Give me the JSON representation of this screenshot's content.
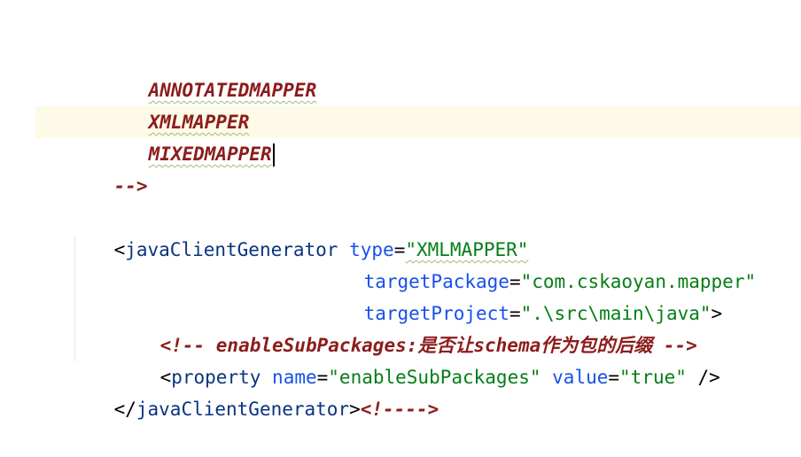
{
  "editor": {
    "lines": {
      "l1": "ANNOTATEDMAPPER",
      "l2": "XMLMAPPER",
      "l3": "MIXEDMAPPER",
      "l4": "-->",
      "l6": {
        "open": "<",
        "tag": "javaClientGenerator",
        "attr1": "type",
        "eq": "=",
        "val1": "\"XMLMAPPER\""
      },
      "l7": {
        "attr": "targetPackage",
        "eq": "=",
        "val": "\"com.cskaoyan.mapper\""
      },
      "l8": {
        "attr": "targetProject",
        "eq": "=",
        "val": "\".\\src\\main\\java\"",
        "close": ">"
      },
      "l9": {
        "comment_open": "<!-- enableSubPackages:",
        "comment_cjk1": "是否让",
        "comment_mid": "schema",
        "comment_cjk2": "作为包的后缀",
        "comment_close": " -->"
      },
      "l10": {
        "open": "<",
        "tag": "property",
        "attr1": "name",
        "eq1": "=",
        "val1": "\"enableSubPackages\"",
        "attr2": "value",
        "eq2": "=",
        "val2": "\"true\"",
        "close": " />"
      },
      "l11": {
        "open": "</",
        "tag": "javaClientGenerator",
        "close": ">",
        "comment": "<!---->"
      }
    },
    "colors": {
      "comment": "#8c1c1c",
      "tag": "#0b3380",
      "attribute": "#1750eb",
      "value": "#067d17",
      "current_line": "#fdfae8"
    }
  }
}
